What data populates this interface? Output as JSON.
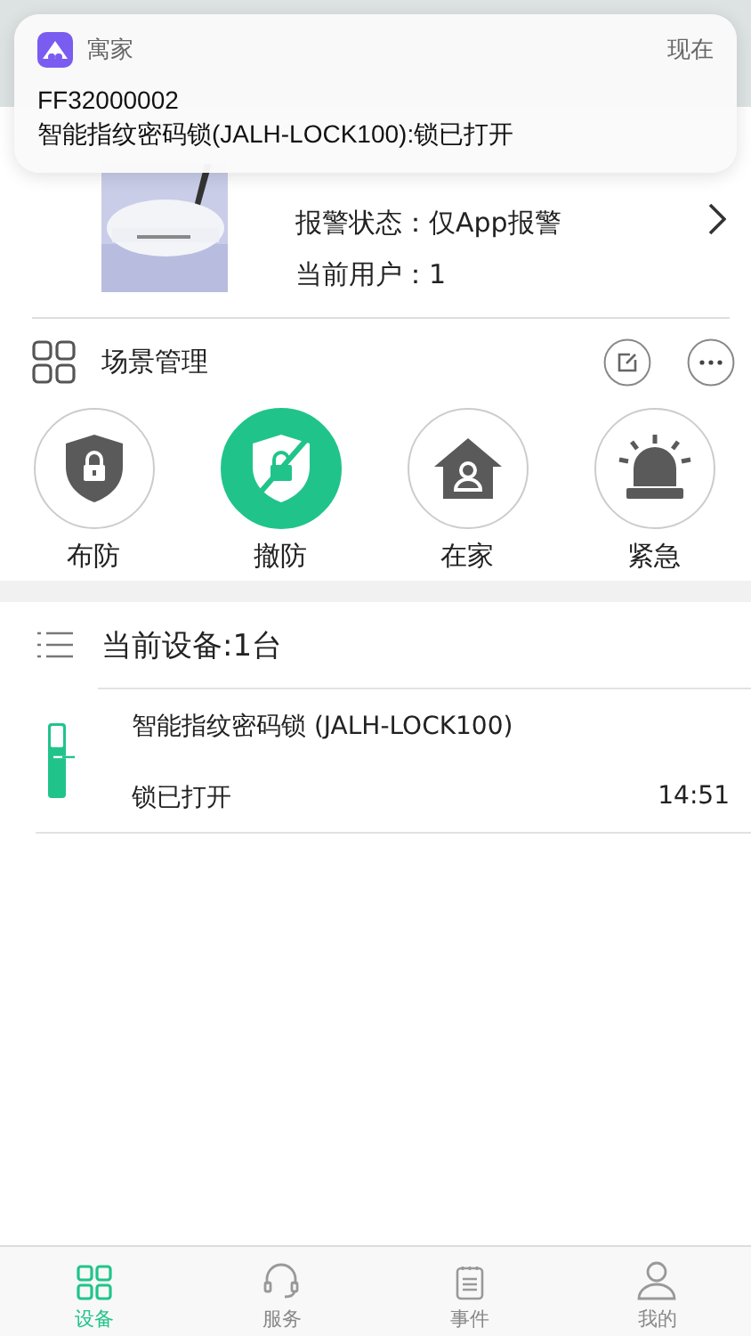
{
  "notification": {
    "app": "寓家",
    "time": "现在",
    "title": "FF32000002",
    "body": "智能指纹密码锁(JALH-LOCK100):锁已打开"
  },
  "host": {
    "fields": [
      "报警状态：仅App报警",
      "当前用户：1"
    ]
  },
  "scenes": {
    "title": "场景管理",
    "modes": [
      {
        "kind": "arm",
        "label": "布防",
        "selected": false
      },
      {
        "kind": "disarm",
        "label": "撤防",
        "selected": true
      },
      {
        "kind": "home",
        "label": "在家",
        "selected": false
      },
      {
        "kind": "emergency",
        "label": "紧急",
        "selected": false
      }
    ]
  },
  "devices": {
    "title": "当前设备:1台",
    "items": [
      {
        "name": "智能指纹密码锁 (JALH-LOCK100)",
        "status": "锁已打开",
        "time": "14:51"
      }
    ]
  },
  "tabs": [
    {
      "kind": "devices",
      "label": "设备",
      "selected": true
    },
    {
      "kind": "service",
      "label": "服务",
      "selected": false
    },
    {
      "kind": "events",
      "label": "事件",
      "selected": false
    },
    {
      "kind": "me",
      "label": "我的",
      "selected": false
    }
  ]
}
